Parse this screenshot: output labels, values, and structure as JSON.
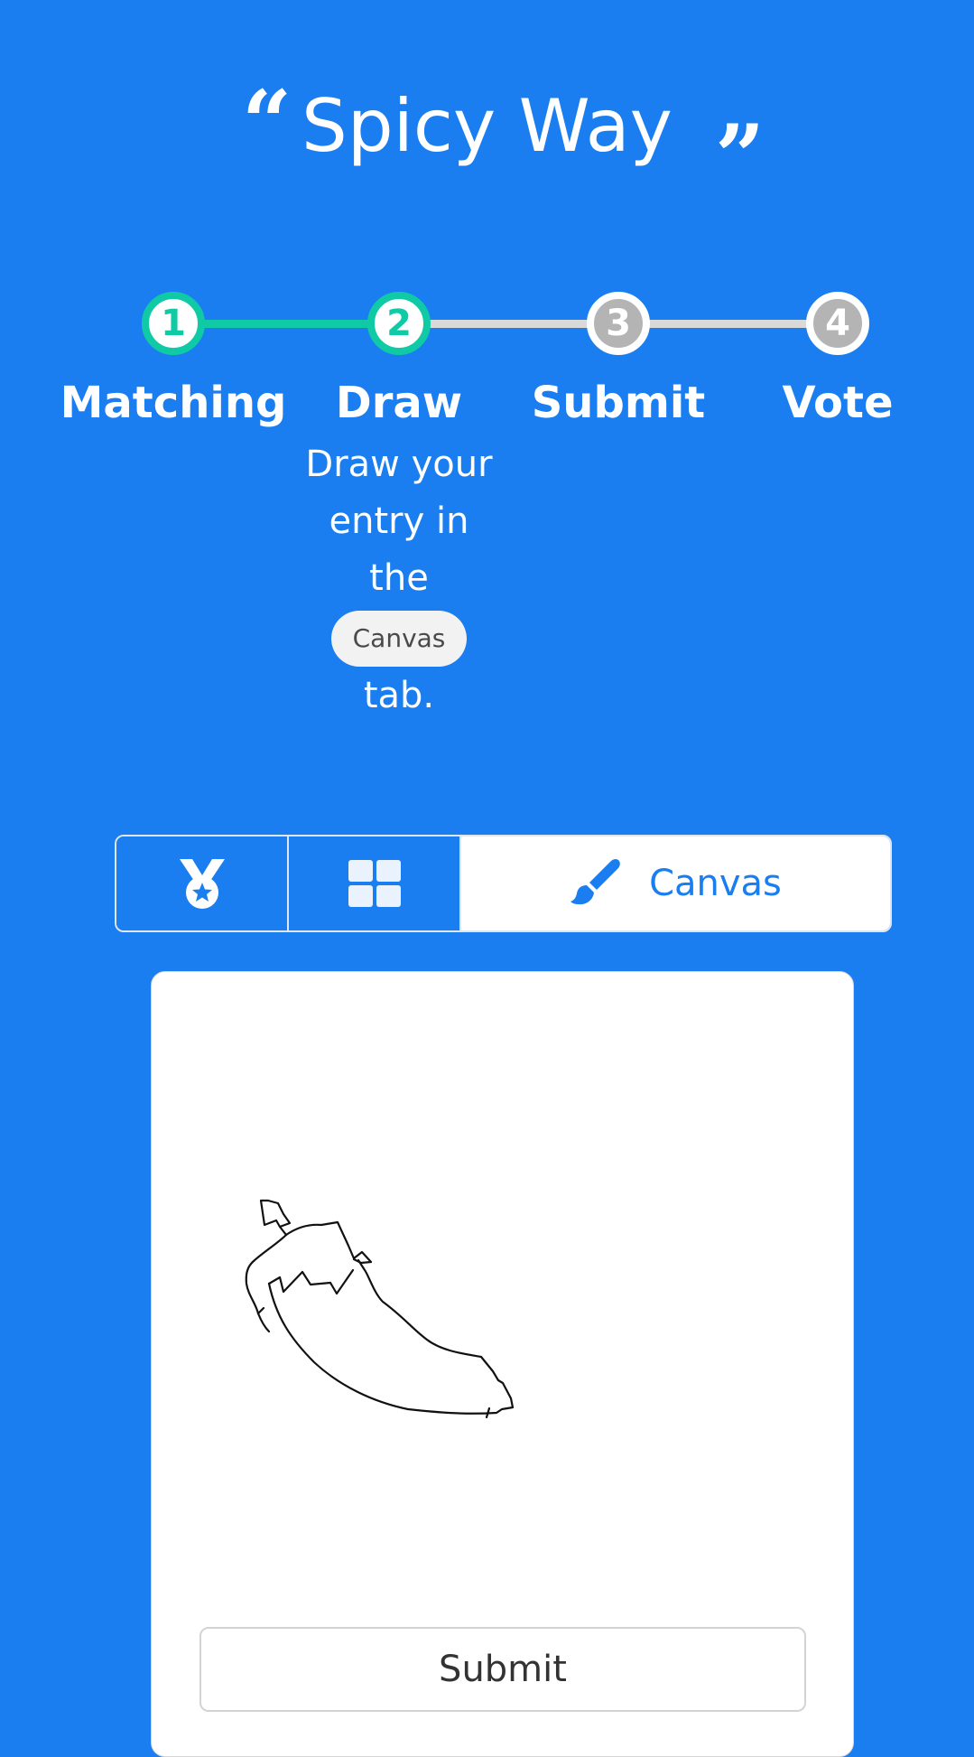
{
  "header": {
    "title": "Spicy Way",
    "open_quote": "“",
    "close_quote": "”"
  },
  "stepper": {
    "steps": [
      {
        "number": "1",
        "label": "Matching",
        "status": "completed"
      },
      {
        "number": "2",
        "label": "Draw",
        "status": "current"
      },
      {
        "number": "3",
        "label": "Submit",
        "status": "pending"
      },
      {
        "number": "4",
        "label": "Vote",
        "status": "pending"
      }
    ],
    "current_description": {
      "line1": "Draw your",
      "line2": "entry in",
      "line3": "the",
      "pill": "Canvas",
      "line4": "tab."
    }
  },
  "tabs": {
    "items": [
      {
        "icon": "medal-icon",
        "label": ""
      },
      {
        "icon": "grid-icon",
        "label": ""
      },
      {
        "icon": "paintbrush-icon",
        "label": "Canvas"
      }
    ],
    "active_index": 2
  },
  "canvas_card": {
    "submit_label": "Submit"
  },
  "colors": {
    "background": "#1a7ef0",
    "completed_step": "#0fcaa4",
    "pending_step": "#b4b4b4",
    "pending_line": "#d9d9d9",
    "active_tab_text": "#1a7ef0"
  }
}
